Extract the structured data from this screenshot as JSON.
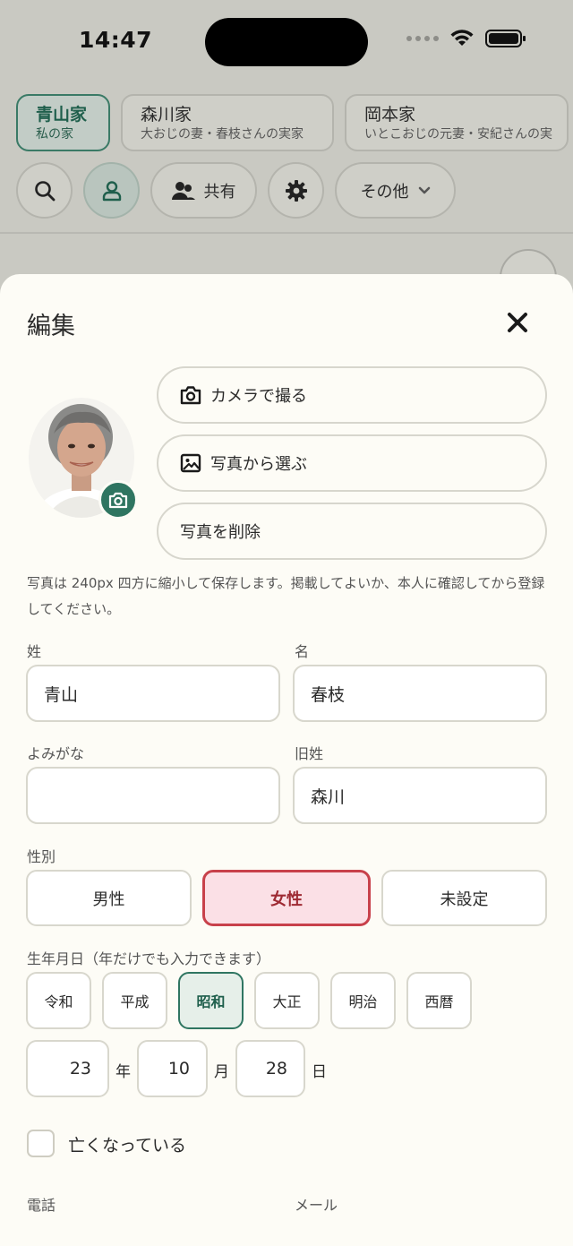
{
  "status_bar": {
    "time": "14:47"
  },
  "family_tabs": [
    {
      "name": "青山家",
      "subtitle": "私の家"
    },
    {
      "name": "森川家",
      "subtitle": "大おじの妻・春枝さんの実家"
    },
    {
      "name": "岡本家",
      "subtitle": "いとこおじの元妻・安紀さんの実"
    }
  ],
  "toolbar": {
    "share_label": "共有",
    "more_label": "その他"
  },
  "sheet": {
    "title": "編集",
    "photo_buttons": {
      "camera": "カメラで撮る",
      "choose": "写真から選ぶ",
      "delete": "写真を削除"
    },
    "photo_note": "写真は 240px 四方に縮小して保存します。掲載してよいか、本人に確認してから登録してください。"
  },
  "form": {
    "last_name": {
      "label": "姓",
      "value": "青山"
    },
    "first_name": {
      "label": "名",
      "value": "春枝"
    },
    "reading": {
      "label": "よみがな",
      "value": ""
    },
    "maiden_name": {
      "label": "旧姓",
      "value": "森川"
    },
    "gender": {
      "label": "性別",
      "options": [
        "男性",
        "女性",
        "未設定"
      ],
      "selected": "女性"
    },
    "birthday": {
      "label": "生年月日（年だけでも入力できます）",
      "eras": [
        "令和",
        "平成",
        "昭和",
        "大正",
        "明治",
        "西暦"
      ],
      "selected_era": "昭和",
      "year": "23",
      "year_unit": "年",
      "month": "10",
      "month_unit": "月",
      "day": "28",
      "day_unit": "日"
    },
    "deceased": {
      "label": "亡くなっている",
      "checked": false
    },
    "phone_label": "電話",
    "email_label": "メール"
  },
  "colors": {
    "accent": "#2f7561",
    "female_selected_bg": "#fbe0e6",
    "female_selected_border": "#c8414b",
    "sheet_bg": "#fdfcf6"
  }
}
